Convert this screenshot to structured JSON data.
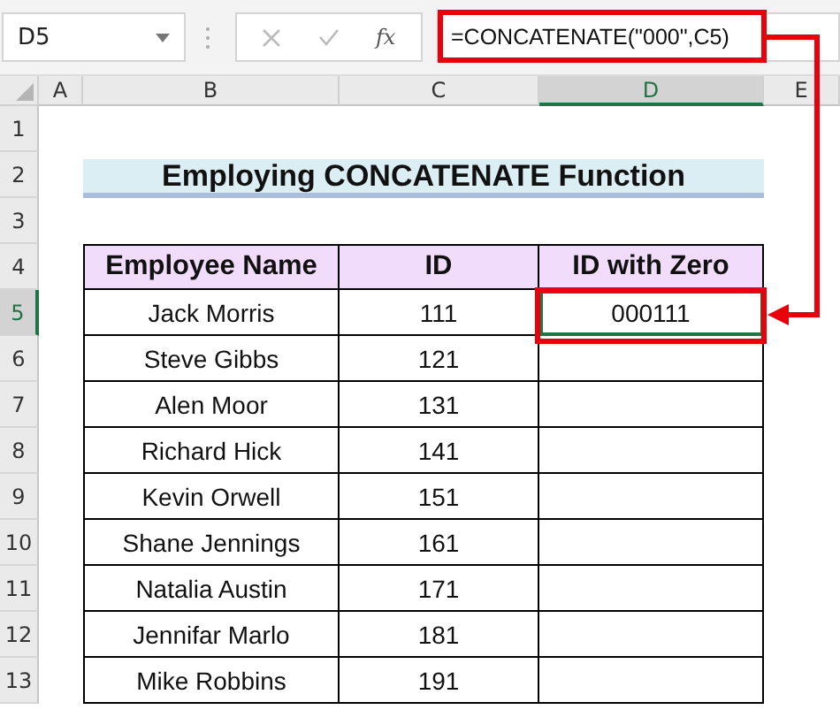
{
  "name_box": "D5",
  "function_button": "fx",
  "formula_bar": {
    "formula": "=CONCATENATE(\"000\",C5)"
  },
  "columns": [
    {
      "label": "A",
      "selected": false
    },
    {
      "label": "B",
      "selected": false
    },
    {
      "label": "C",
      "selected": false
    },
    {
      "label": "D",
      "selected": true
    },
    {
      "label": "E",
      "selected": false
    }
  ],
  "rows": [
    {
      "label": "1",
      "selected": false
    },
    {
      "label": "2",
      "selected": false
    },
    {
      "label": "3",
      "selected": false
    },
    {
      "label": "4",
      "selected": false
    },
    {
      "label": "5",
      "selected": true
    },
    {
      "label": "6",
      "selected": false
    },
    {
      "label": "7",
      "selected": false
    },
    {
      "label": "8",
      "selected": false
    },
    {
      "label": "9",
      "selected": false
    },
    {
      "label": "10",
      "selected": false
    },
    {
      "label": "11",
      "selected": false
    },
    {
      "label": "12",
      "selected": false
    },
    {
      "label": "13",
      "selected": false
    }
  ],
  "title": "Employing CONCATENATE Function",
  "table": {
    "columns": [
      "Employee Name",
      "ID",
      "ID with Zero"
    ],
    "rows": [
      {
        "name": "Jack Morris",
        "id": "111",
        "id_with_zero": "000111",
        "selected": true
      },
      {
        "name": "Steve Gibbs",
        "id": "121",
        "selected": false
      },
      {
        "name": "Alen Moor",
        "id": "131",
        "selected": false
      },
      {
        "name": "Richard Hick",
        "id": "141",
        "selected": false
      },
      {
        "name": "Kevin Orwell",
        "id": "151",
        "selected": false
      },
      {
        "name": "Shane Jennings",
        "id": "161",
        "selected": false
      },
      {
        "name": "Natalia Austin",
        "id": "171",
        "selected": false
      },
      {
        "name": "Jennifar Marlo",
        "id": "181",
        "selected": false
      },
      {
        "name": "Mike Robbins",
        "id": "191",
        "selected": false
      }
    ]
  }
}
